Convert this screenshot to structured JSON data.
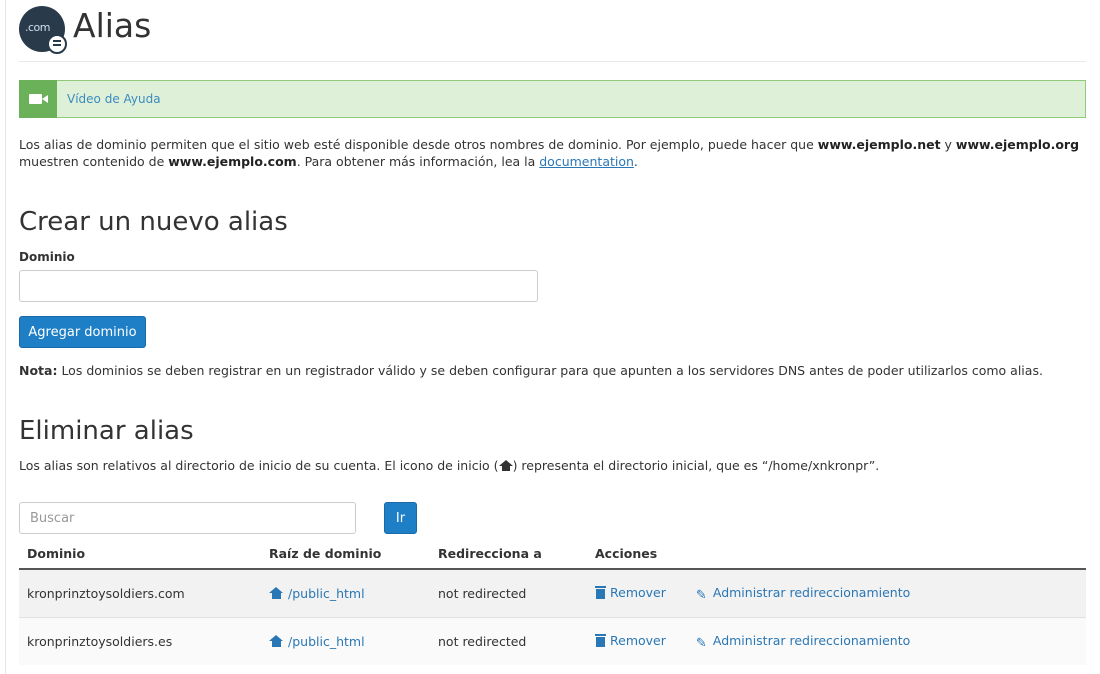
{
  "header": {
    "logo_text": ".com",
    "title": "Alias"
  },
  "help": {
    "link_label": "Vídeo de Ayuda"
  },
  "intro": {
    "text_1": "Los alias de dominio permiten que el sitio web esté disponible desde otros nombres de dominio. Por ejemplo, puede hacer que ",
    "example_net": "www.ejemplo.net",
    "text_2": " y ",
    "example_org": "www.ejemplo.org",
    "text_3": " muestren contenido de ",
    "example_com": "www.ejemplo.com",
    "text_4": ". Para obtener más información, lea la ",
    "doc_link": "documentation",
    "text_5": "."
  },
  "create": {
    "title": "Crear un nuevo alias",
    "domain_label": "Dominio",
    "domain_value": "",
    "add_button": "Agregar dominio",
    "note_label": "Nota:",
    "note_text": " Los dominios se deben registrar en un registrador válido y se deben configurar para que apunten a los servidores DNS antes de poder utilizarlos como alias."
  },
  "delete": {
    "title": "Eliminar alias",
    "desc_1": "Los alias son relativos al directorio de inicio de su cuenta. El icono de inicio (",
    "desc_2": ") representa el directorio inicial, que es “/home/xnkronpr”.",
    "search_placeholder": "Buscar",
    "go_button": "Ir"
  },
  "table": {
    "columns": [
      "Dominio",
      "Raíz de dominio",
      "Redirecciona a",
      "Acciones"
    ],
    "rows": [
      {
        "domain": "kronprinztoysoldiers.com",
        "root": "/public_html",
        "redirect": "not redirected",
        "remove": "Remover",
        "manage": "Administrar redireccionamiento"
      },
      {
        "domain": "kronprinztoysoldiers.es",
        "root": "/public_html",
        "redirect": "not redirected",
        "remove": "Remover",
        "manage": "Administrar redireccionamiento"
      }
    ]
  },
  "colors": {
    "primary": "#1e7fc6",
    "link": "#2a77b5",
    "help_bg": "#dff0d8",
    "help_icon_bg": "#6bb15a"
  },
  "icons": [
    "domain-logo-icon",
    "video-camera-icon",
    "home-icon",
    "trash-icon",
    "pencil-icon"
  ]
}
